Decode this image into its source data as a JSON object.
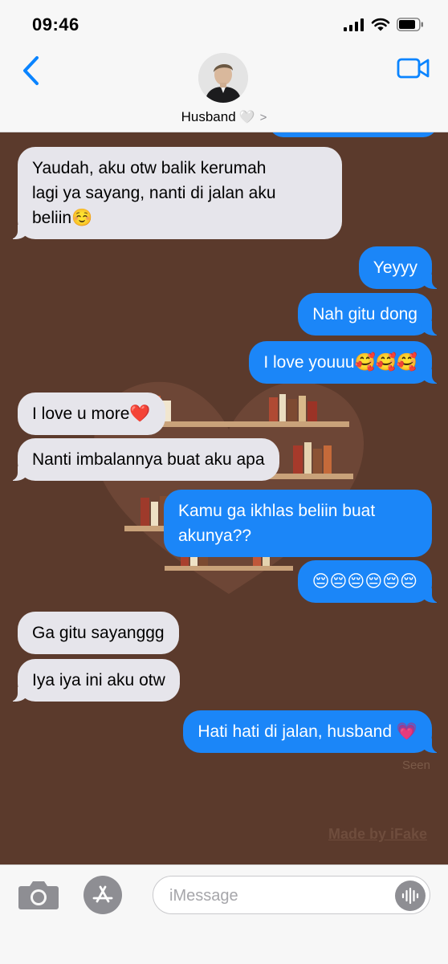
{
  "status_bar": {
    "time": "09:46",
    "icons": [
      "signal-icon",
      "wifi-icon",
      "battery-icon"
    ]
  },
  "header": {
    "contact_name": "Husband",
    "contact_emoji": "🤍",
    "chevron": ">",
    "icons": [
      "back-chevron-icon",
      "video-camera-icon"
    ]
  },
  "messages": [
    {
      "side": "in",
      "text": "Yaudah, aku otw balik  kerumah\nlagi ya sayang, nanti di jalan aku\nbeliin☺️"
    },
    {
      "side": "out",
      "text": "Yeyyy"
    },
    {
      "side": "out",
      "text": "Nah gitu dong"
    },
    {
      "side": "out",
      "text": "I love youuu🥰🥰🥰"
    },
    {
      "side": "in",
      "text": "I love u more❤️"
    },
    {
      "side": "in",
      "text": "Nanti imbalannya buat aku apa"
    },
    {
      "side": "out",
      "text": "Kamu ga ikhlas beliin buat\nakunya??"
    },
    {
      "side": "out",
      "text": "😔😔😔😔😔😔"
    },
    {
      "side": "in",
      "text": "Ga gitu sayanggg"
    },
    {
      "side": "in",
      "text": "Iya iya ini aku otw"
    },
    {
      "side": "out",
      "text": "Hati hati di jalan, husband 💗"
    }
  ],
  "seen_label": "Seen",
  "watermark": "Made by iFake",
  "input_bar": {
    "placeholder": "iMessage",
    "value": "",
    "icons": [
      "camera-icon",
      "app-store-icon",
      "audio-waveform-icon"
    ]
  },
  "colors": {
    "chat_background": "#5b3a2c",
    "incoming_bubble": "#e6e5eb",
    "outgoing_bubble": "#1b86f8",
    "accent": "#0a84ff"
  }
}
